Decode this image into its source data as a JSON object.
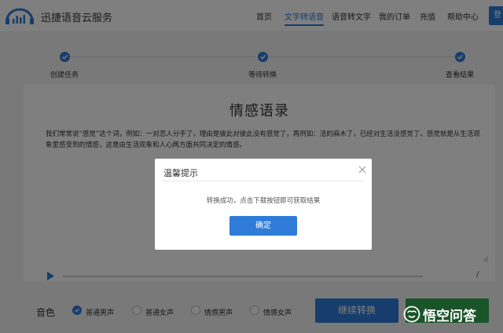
{
  "header": {
    "brand": "迅捷语音云服务",
    "nav": [
      "首页",
      "文字转语音",
      "语音转文字",
      "我的订单",
      "充值",
      "帮助中心"
    ],
    "login": "登"
  },
  "steps": [
    "创建任务",
    "等待转换",
    "查看结果"
  ],
  "document": {
    "title": "情感语录",
    "body": "我们常常说“感觉”这个词，例如：一对恋人分手了，理由是彼此对彼此没有感觉了，再例如：活的麻木了，已经对生活没感觉了。感觉就是从生活现象里感受到的情感，这是由生活现象和人心两方面共同决定的情感。"
  },
  "player": {
    "time_separator": "/",
    "progress": 0
  },
  "voice": {
    "label": "音色",
    "options": [
      "普通男声",
      "普通女声",
      "情感男声",
      "情感女声"
    ],
    "selected": "普通男声"
  },
  "actions": {
    "convert": "继续转换"
  },
  "modal": {
    "title": "温馨提示",
    "message": "转换成功，点击下载按钮即可获取结果",
    "ok": "确定"
  },
  "watermark": {
    "text": "悟空问答"
  },
  "colors": {
    "accent": "#2f7bd8",
    "green": "#34a853",
    "overlay": "rgba(0,0,0,0.5)"
  }
}
